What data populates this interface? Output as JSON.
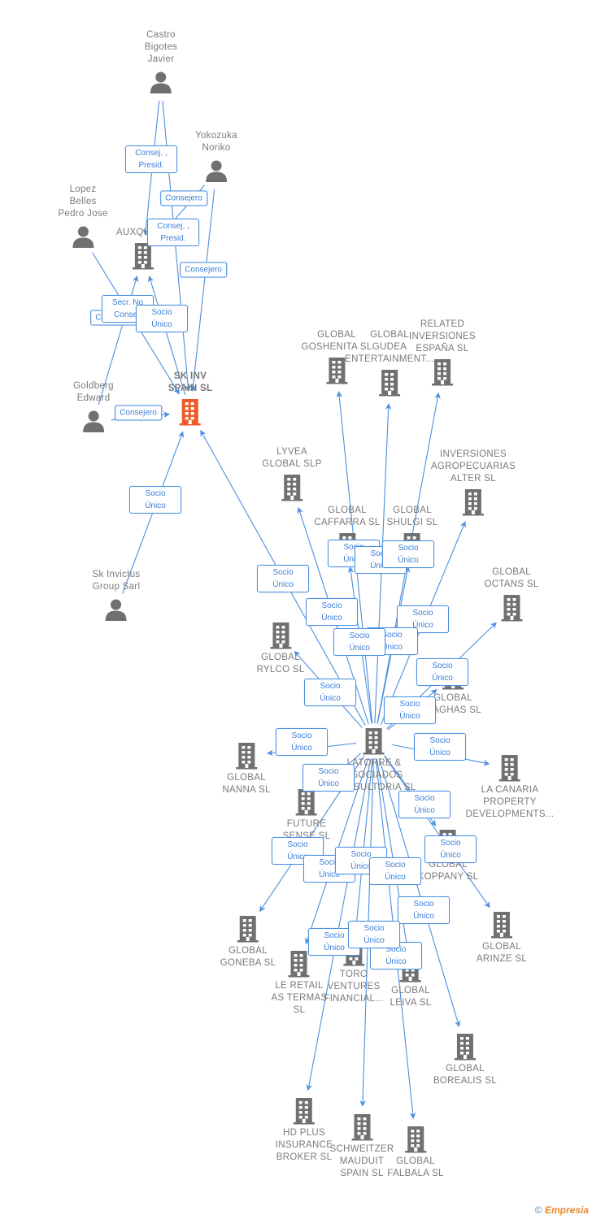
{
  "colors": {
    "edge": "#4a8fe0",
    "node": "#707070",
    "focus": "#f05a28"
  },
  "nodes": [
    {
      "id": "castro",
      "type": "person",
      "label": "Castro\nBigotes\nJavier"
    },
    {
      "id": "yokozuka",
      "type": "person",
      "label": "Yokozuka\nNoriko"
    },
    {
      "id": "lopez",
      "type": "person",
      "label": "Lopez\nBelles\nPedro Jose"
    },
    {
      "id": "auxquim",
      "type": "company",
      "label": "AUXQUIM..."
    },
    {
      "id": "goldberg",
      "type": "person",
      "label": "Goldberg\nEdward"
    },
    {
      "id": "skinv",
      "type": "focus",
      "label": "SK INV\nSPAIN  SL"
    },
    {
      "id": "skinvictus",
      "type": "person",
      "label": "Sk Invictus\nGroup Sarl"
    },
    {
      "id": "latorre",
      "type": "company",
      "label": "LATORRE &\nASOCIADOS\nCONSULTORIA SL"
    },
    {
      "id": "goshenita",
      "type": "company",
      "label": "GLOBAL\nGOSHENITA SL"
    },
    {
      "id": "gudea",
      "type": "company",
      "label": "GLOBAL\nGUDEA\nENTERTAINMENT..."
    },
    {
      "id": "related",
      "type": "company",
      "label": "RELATED\nINVERSIONES\nESPAÑA  SL"
    },
    {
      "id": "lyvea",
      "type": "company",
      "label": "LYVEA\nGLOBAL  SLP"
    },
    {
      "id": "agro",
      "type": "company",
      "label": "INVERSIONES\nAGROPECUARIAS\nALTER  SL"
    },
    {
      "id": "caffarra",
      "type": "company",
      "label": "GLOBAL\nCAFFARRA  SL"
    },
    {
      "id": "shulgi",
      "type": "company",
      "label": "GLOBAL\nSHULGI  SL"
    },
    {
      "id": "octans",
      "type": "company",
      "label": "GLOBAL\nOCTANS  SL"
    },
    {
      "id": "rylco",
      "type": "company",
      "label": "GLOBAL\nRYLCO  SL"
    },
    {
      "id": "maghas",
      "type": "company",
      "label": "GLOBAL\nMAGHAS  SL"
    },
    {
      "id": "nanna",
      "type": "company",
      "label": "GLOBAL\nNANNA  SL"
    },
    {
      "id": "canaria",
      "type": "company",
      "label": "LA CANARIA\nPROPERTY\nDEVELOPMENTS..."
    },
    {
      "id": "future",
      "type": "company",
      "label": "FUTURE\nSENSE  SL"
    },
    {
      "id": "koppany",
      "type": "company",
      "label": "GLOBAL\nKOPPANY  SL"
    },
    {
      "id": "goneba",
      "type": "company",
      "label": "GLOBAL\nGONEBA  SL"
    },
    {
      "id": "arinze",
      "type": "company",
      "label": "GLOBAL\nARINZE  SL"
    },
    {
      "id": "leretail",
      "type": "company",
      "label": "LE RETAIL\nAS TERMAS\nSL"
    },
    {
      "id": "toro",
      "type": "company",
      "label": "TORO\nVENTURES\nFINANCIAL..."
    },
    {
      "id": "leiva",
      "type": "company",
      "label": "GLOBAL\nLEIVA  SL"
    },
    {
      "id": "borealis",
      "type": "company",
      "label": "GLOBAL\nBOREALIS  SL"
    },
    {
      "id": "hdplus",
      "type": "company",
      "label": "HD PLUS\nINSURANCE\nBROKER  SL"
    },
    {
      "id": "schweitzer",
      "type": "company",
      "label": "SCHWEITZER\nMAUDUIT\nSPAIN SL"
    },
    {
      "id": "falbala",
      "type": "company",
      "label": "GLOBAL\nFALBALA  SL"
    }
  ],
  "edges": [
    {
      "from": "castro",
      "to": "auxquim",
      "label": "Consej. , Presid."
    },
    {
      "from": "castro",
      "to": "skinv",
      "label": "Consej. , Presid."
    },
    {
      "from": "yokozuka",
      "to": "auxquim",
      "label": "Consejero"
    },
    {
      "from": "yokozuka",
      "to": "skinv",
      "label": "Consejero"
    },
    {
      "from": "goldberg",
      "to": "auxquim",
      "label": "Consejero"
    },
    {
      "from": "lopez",
      "to": "skinv",
      "label": "Secr.  No Consej."
    },
    {
      "from": "skinv",
      "to": "auxquim",
      "label": "Socio Único"
    },
    {
      "from": "goldberg",
      "to": "skinv",
      "label": "Consejero"
    },
    {
      "from": "skinvictus",
      "to": "skinv",
      "label": "Socio Único"
    },
    {
      "from": "latorre",
      "to": "skinv",
      "label": "Socio Único"
    },
    {
      "from": "latorre",
      "to": "goshenita",
      "label": "Socio Único"
    },
    {
      "from": "latorre",
      "to": "gudea",
      "label": "Socio Único"
    },
    {
      "from": "latorre",
      "to": "related",
      "label": "Socio Único"
    },
    {
      "from": "latorre",
      "to": "lyvea",
      "label": "Socio Único"
    },
    {
      "from": "latorre",
      "to": "agro",
      "label": "Socio Único"
    },
    {
      "from": "latorre",
      "to": "shulgi",
      "label": "Socio Único"
    },
    {
      "from": "latorre",
      "to": "caffarra",
      "label": "Socio Único"
    },
    {
      "from": "latorre",
      "to": "rylco",
      "label": "Socio Único"
    },
    {
      "from": "latorre",
      "to": "octans",
      "label": "Socio Único"
    },
    {
      "from": "latorre",
      "to": "maghas",
      "label": "Socio Único"
    },
    {
      "from": "latorre",
      "to": "nanna",
      "label": "Socio Único"
    },
    {
      "from": "latorre",
      "to": "canaria",
      "label": "Socio Único"
    },
    {
      "from": "latorre",
      "to": "future",
      "label": "Socio Único"
    },
    {
      "from": "latorre",
      "to": "koppany",
      "label": "Socio Único"
    },
    {
      "from": "latorre",
      "to": "goneba",
      "label": "Socio Único"
    },
    {
      "from": "latorre",
      "to": "arinze",
      "label": "Socio Único"
    },
    {
      "from": "latorre",
      "to": "leretail",
      "label": "Socio Único"
    },
    {
      "from": "latorre",
      "to": "toro",
      "label": "Socio Único"
    },
    {
      "from": "latorre",
      "to": "leiva",
      "label": "Socio Único"
    },
    {
      "from": "latorre",
      "to": "borealis",
      "label": "Socio Único"
    },
    {
      "from": "latorre",
      "to": "hdplus",
      "label": "Socio Único"
    },
    {
      "from": "latorre",
      "to": "schweitzer",
      "label": "Socio Único"
    },
    {
      "from": "latorre",
      "to": "falbala",
      "label": "Socio Único"
    }
  ],
  "footer": {
    "copyright": "©",
    "brand": "Empresia"
  }
}
